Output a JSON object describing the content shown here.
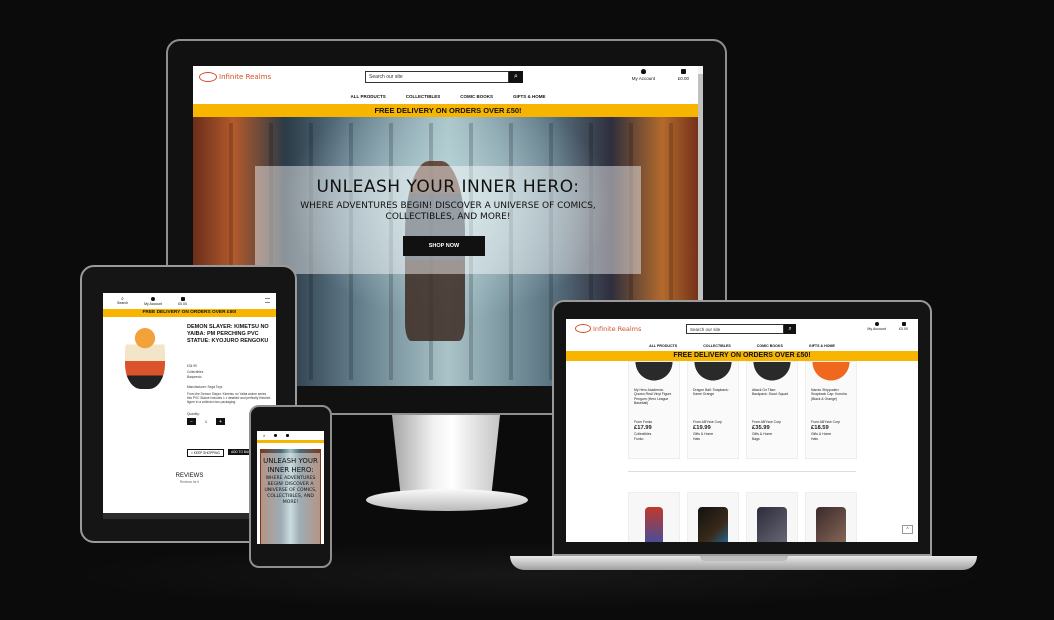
{
  "site": {
    "logo_text": "Infinite Realms",
    "search_placeholder": "Search our site",
    "search_icon": "search-icon",
    "account_label": "My Account",
    "bag_total": "£0.00",
    "nav": [
      "ALL PRODUCTS",
      "COLLECTIBLES",
      "COMIC BOOKS",
      "GIFTS & HOME"
    ],
    "banner": "FREE DELIVERY ON ORDERS OVER £50!",
    "colors": {
      "brand": "#d1502a",
      "banner": "#f7b500",
      "dark": "#111111"
    }
  },
  "desktop": {
    "hero_title": "UNLEASH YOUR INNER HERO:",
    "hero_sub": "WHERE ADVENTURES BEGIN! DISCOVER A UNIVERSE OF COMICS, COLLECTIBLES, AND MORE!",
    "hero_button": "SHOP NOW"
  },
  "tablet": {
    "top_search": "Search",
    "top_account": "My Account",
    "top_bag": "£0.00",
    "product_title": "DEMON SLAYER: KIMETSU NO YAIBA: PM PERCHING PVC STATUE: KYOJURO RENGOKU",
    "price": "£34.99",
    "category": "Collectibles",
    "brand": "Banpresto",
    "description_1": "Manufacturer: Sega Toys",
    "description_2": "From the Demon Slayer: Kimetsu no Yaiba anime series this PVC Statue includes 1 x detailed and perfectly finished figure in a collector box packaging.",
    "quantity_label": "Quantity:",
    "quantity_value": "1",
    "minus": "−",
    "plus": "+",
    "keep_shopping": "< KEEP SHOPPING",
    "add_to_bag": "ADD TO BAG",
    "reviews_title": "REVIEWS",
    "reviews_sub": "Reviews for it"
  },
  "phone": {
    "hero_title": "UNLEASH YOUR INNER HERO:",
    "hero_sub": "WHERE ADVENTURES BEGIN! DISCOVER A UNIVERSE OF COMICS, COLLECTIBLES, AND MORE!"
  },
  "laptop": {
    "products": [
      {
        "name": "My Hero Academia: Quown Real Vinyl Figure Pengum (Hero League Baseball)",
        "from": "From Funko",
        "price": "£17.99",
        "category": "Collectibles",
        "brand": "Funko"
      },
      {
        "name": "Dragon Ball: Snapback: Kame Orange",
        "from": "From ABYsse Corp",
        "price": "£19.99",
        "category": "Gifts & Home",
        "brand": "Hats"
      },
      {
        "name": "Attack On Titan: Backpack: Scout Squad",
        "from": "From ABYsse Corp",
        "price": "£35.99",
        "category": "Gifts & Home",
        "brand": "Bags"
      },
      {
        "name": "Naruto Shippuden: Snapback Cap: Konoha (Black & Orange)",
        "from": "From ABYsse Corp",
        "price": "£18.59",
        "category": "Gifts & Home",
        "brand": "Hats"
      }
    ],
    "back_to_top": "^"
  }
}
